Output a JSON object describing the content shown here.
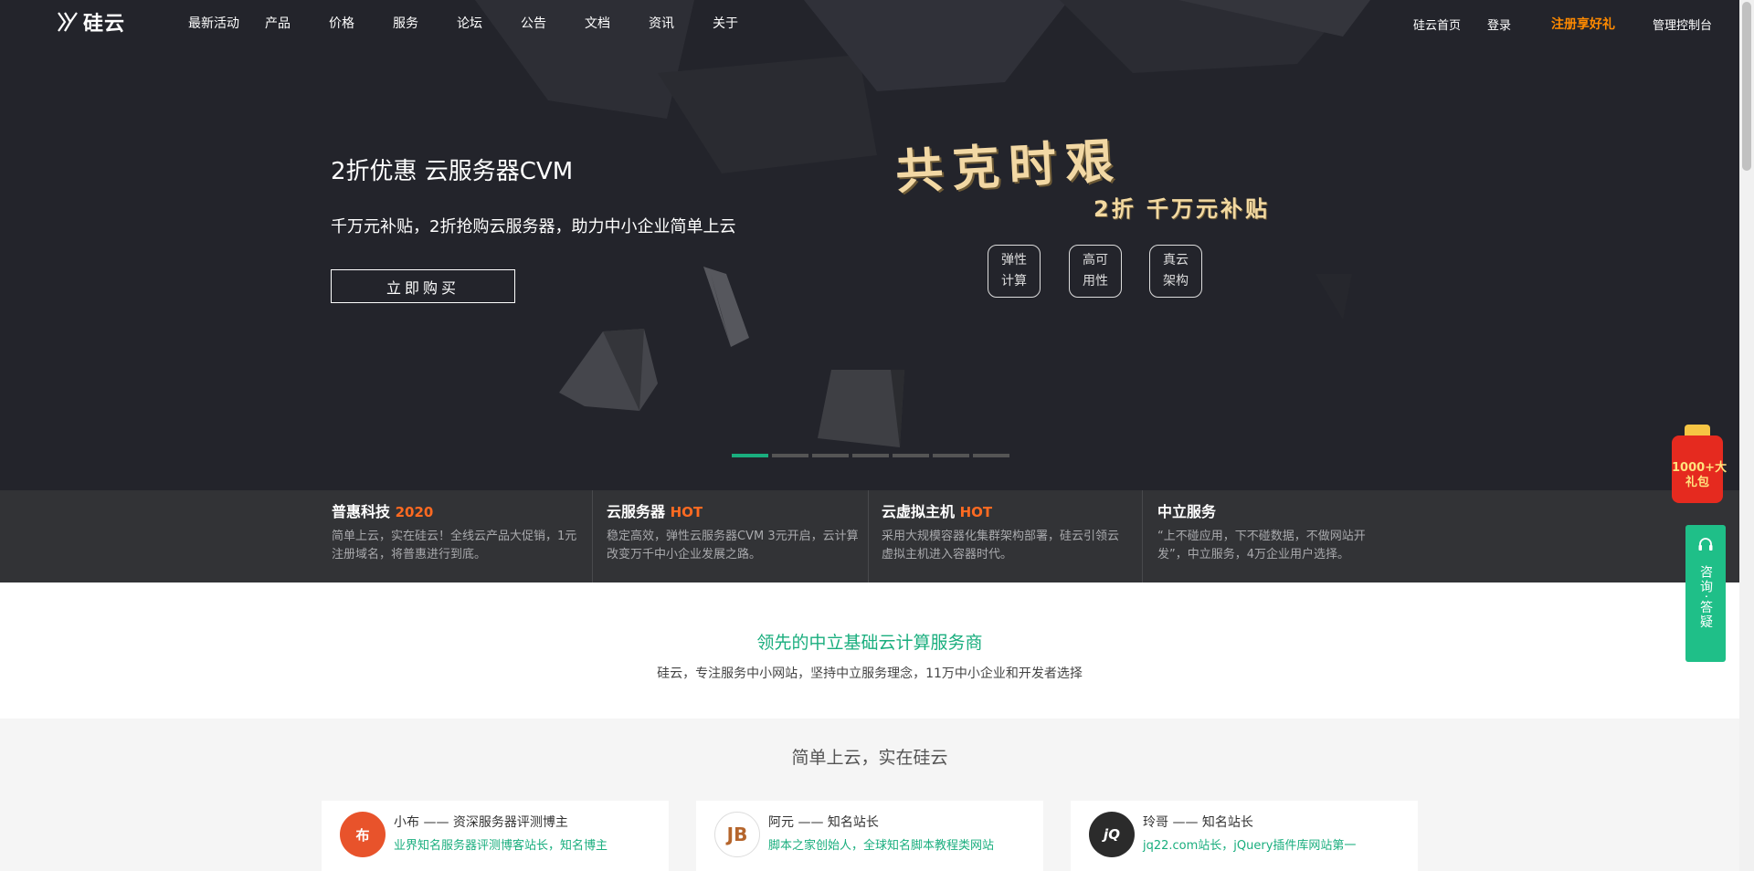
{
  "nav": {
    "logo_text": "硅云",
    "menu": [
      "最新活动",
      "产品",
      "价格",
      "服务",
      "论坛",
      "公告",
      "文档",
      "资讯",
      "关于"
    ],
    "home": "硅云首页",
    "login": "登录",
    "register": "注册享好礼",
    "console": "管理控制台"
  },
  "hero": {
    "title": "2折优惠 云服务器CVM",
    "subtitle": "千万元补贴，2折抢购云服务器，助力中小企业简单上云",
    "button": "立即购买",
    "art_title": "共克时艰",
    "art_subtitle": "2折 千万元补贴",
    "pills": [
      "弹性计算",
      "高可用性",
      "真云架构"
    ],
    "slide_count": 7,
    "active_slide": 1
  },
  "features": [
    {
      "title": "普惠科技",
      "tag": "2020",
      "desc": "简单上云，实在硅云！全线云产品大促销，1元注册域名，将普惠进行到底。"
    },
    {
      "title": "云服务器",
      "tag": "HOT",
      "desc": "稳定高效，弹性云服务器CVM 3元开启，云计算改变万千中小企业发展之路。"
    },
    {
      "title": "云虚拟主机",
      "tag": "HOT",
      "desc": "采用大规模容器化集群架构部署，硅云引领云虚拟主机进入容器时代。"
    },
    {
      "title": "中立服务",
      "tag": "",
      "desc": "“上不碰应用，下不碰数据，不做网站开发”，中立服务，4万企业用户选择。"
    }
  ],
  "section1": {
    "title": "领先的中立基础云计算服务商",
    "subtitle": "硅云，专注服务中小网站，坚持中立服务理念，11万中小企业和开发者选择"
  },
  "section2": {
    "title": "简单上云，实在硅云",
    "cards": [
      {
        "avatar": "布",
        "name": "小布 —— 资深服务器评测博主",
        "desc": "业界知名服务器评测博客站长，知名博主"
      },
      {
        "avatar": "JB",
        "name": "阿元 —— 知名站长",
        "desc": "脚本之家创始人，全球知名脚本教程类网站"
      },
      {
        "avatar": "jQ",
        "name": "玲哥 —— 知名站长",
        "desc": "jq22.com站长，jQuery插件库网站第一"
      }
    ]
  },
  "floating": {
    "gift_label": "1000+大礼包",
    "consult_label": "咨询·答疑"
  },
  "colors": {
    "accent_green": "#1aae7e",
    "accent_orange": "#ff8a00",
    "hot_red": "#ff6a21",
    "hero_bg": "#23242b"
  }
}
